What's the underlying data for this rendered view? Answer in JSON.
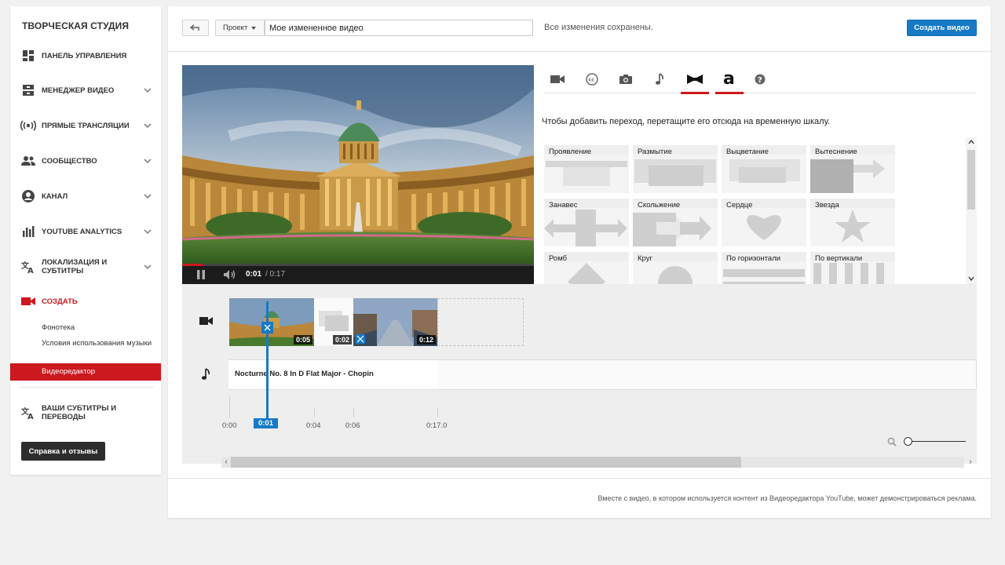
{
  "sidebar": {
    "title": "ТВОРЧЕСКАЯ СТУДИЯ",
    "items": [
      {
        "label": "ПАНЕЛЬ УПРАВЛЕНИЯ",
        "icon": "dashboard-icon"
      },
      {
        "label": "МЕНЕДЖЕР ВИДЕО",
        "icon": "video-manager-icon"
      },
      {
        "label": "ПРЯМЫЕ ТРАНСЛЯЦИИ",
        "icon": "live-icon"
      },
      {
        "label": "СООБЩЕСТВО",
        "icon": "community-icon"
      },
      {
        "label": "КАНАЛ",
        "icon": "channel-icon"
      },
      {
        "label": "YOUTUBE ANALYTICS",
        "icon": "analytics-icon"
      },
      {
        "label": "ЛОКАЛИЗАЦИЯ И СУБТИТРЫ",
        "icon": "translate-icon"
      },
      {
        "label": "СОЗДАТЬ",
        "icon": "create-icon"
      },
      {
        "label": "ВАШИ СУБТИТРЫ И ПЕРЕВОДЫ",
        "icon": "subtitles-icon"
      }
    ],
    "create_subitems": [
      "Фонотека",
      "Условия использования музыки",
      "Видеоредактор"
    ],
    "help_button": "Справка и отзывы",
    "accent_color": "#cc181e"
  },
  "header": {
    "project_button": "Проект",
    "title_value": "Мое измененное видео",
    "saved_status": "Все изменения сохранены.",
    "create_button": "Создать видео",
    "primary_color": "#167ac6"
  },
  "player": {
    "current_time": "0:01",
    "total_time": "/ 0:17",
    "progress": 0.06
  },
  "tools": {
    "tabs": [
      "video-camera-icon",
      "cc-icon",
      "photo-camera-icon",
      "music-note-icon",
      "bowtie-transitions-icon",
      "text-icon",
      "help-icon"
    ],
    "active_tabs": [
      "bowtie-transitions-icon",
      "text-icon"
    ],
    "hint": "Чтобы добавить переход, перетащите его отсюда на временную шкалу.",
    "transitions": [
      "Проявление",
      "Размытие",
      "Выцветание",
      "Вытеснение",
      "Занавес",
      "Скольжение",
      "Сердце",
      "Звезда",
      "Ромб",
      "Круг",
      "По горизонтали",
      "По вертикали"
    ]
  },
  "timeline": {
    "clips": [
      {
        "duration": "0:05"
      },
      {
        "duration": "0:02"
      },
      {
        "duration": "0:12"
      }
    ],
    "audio_track": "Nocturne No. 8 In D Flat Major - Chopin",
    "ruler": [
      "0:00",
      "0:04",
      "0:06",
      "0:17.0"
    ],
    "playhead": "0:01"
  },
  "footer": {
    "note": "Вместе с видео, в котором используется контент из Видеоредактора YouTube, может демонстрироваться реклама."
  }
}
